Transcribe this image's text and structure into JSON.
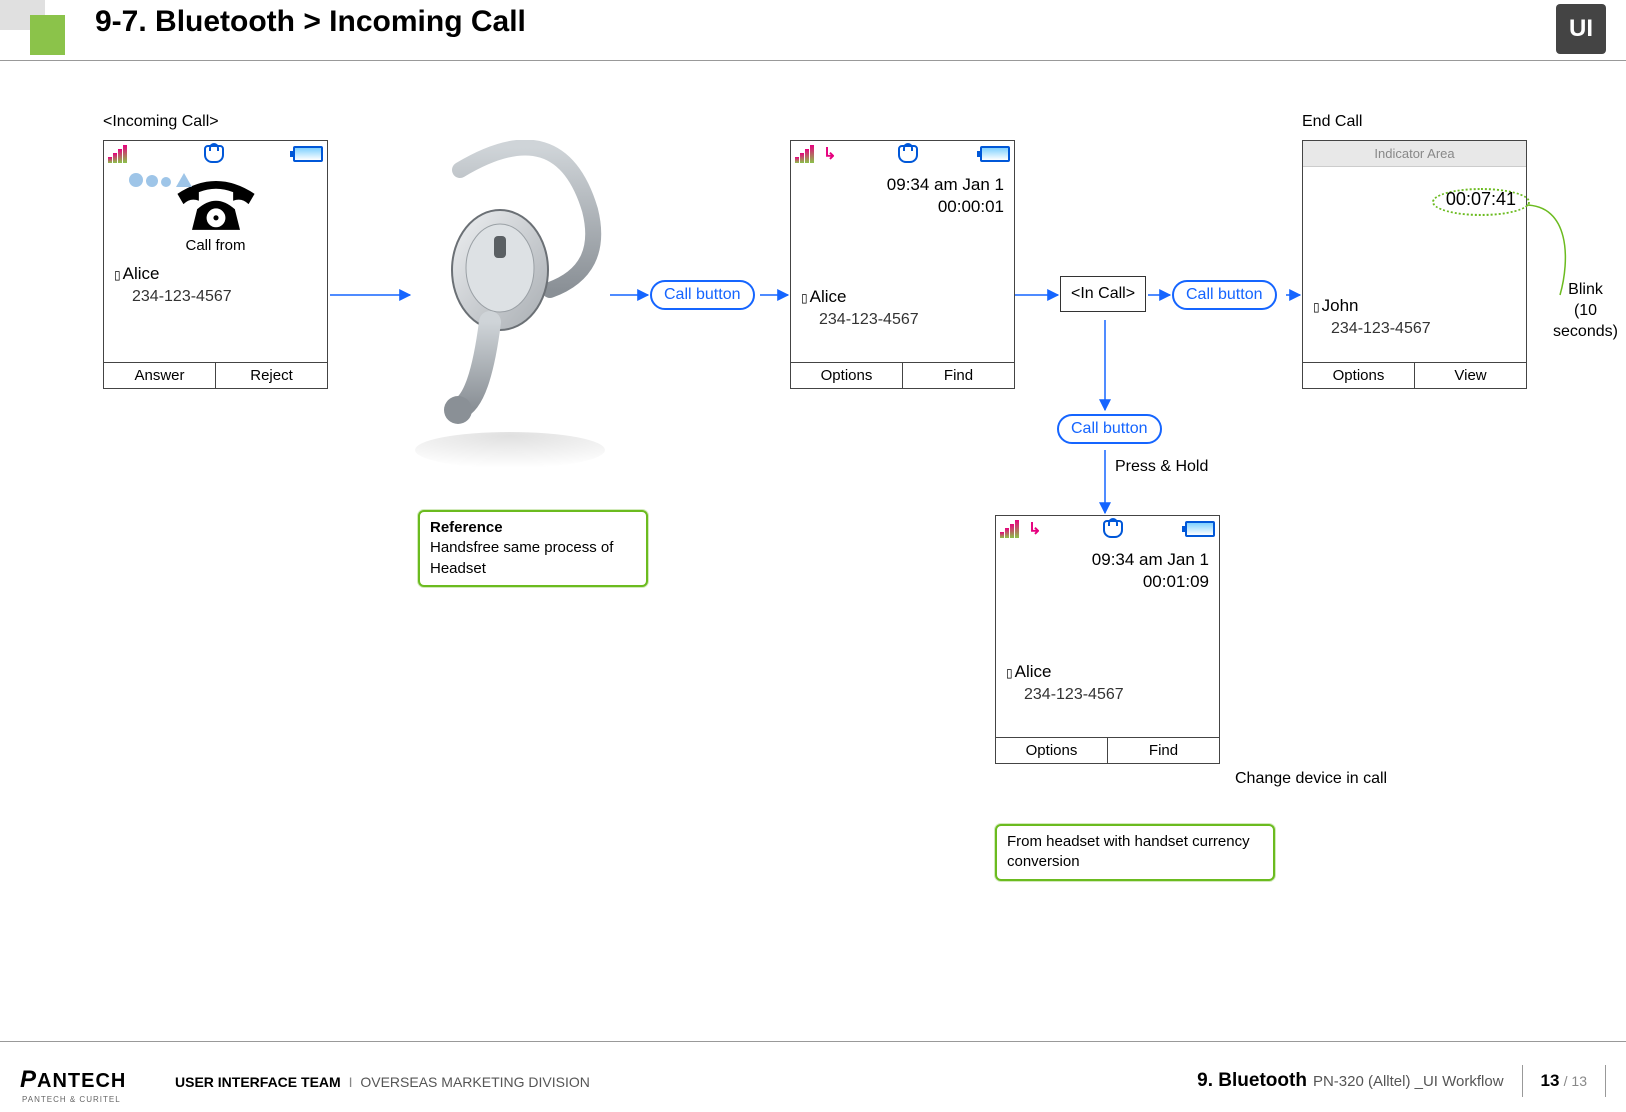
{
  "header": {
    "title": "9-7. Bluetooth > Incoming Call",
    "logo_text": "UI"
  },
  "footer": {
    "brand": "PANTECH",
    "brand_sub": "PANTECH & CURITEL",
    "team_bold": "USER INTERFACE TEAM",
    "team_light": "OVERSEAS MARKETING DIVISION",
    "section": "9. Bluetooth",
    "doc": "PN-320 (Alltel) _UI Workflow",
    "page_current": "13",
    "page_total": "/ 13"
  },
  "labels": {
    "incoming_call": "<Incoming Call>",
    "end_call": "End Call",
    "in_call": "<In Call>",
    "press_hold": "Press & Hold",
    "change_device": "Change device in call",
    "blink": "Blink",
    "blink_sub": "(10 seconds)",
    "indicator_area": "Indicator Area"
  },
  "pills": {
    "call_button_1": "Call button",
    "call_button_2": "Call button",
    "call_button_3": "Call button"
  },
  "notes": {
    "reference_title": "Reference",
    "reference_body": "Handsfree same process of Headset",
    "conversion": "From headset with handset currency conversion"
  },
  "screens": {
    "s1": {
      "call_from": "Call from",
      "name": "Alice",
      "number": "234-123-4567",
      "sk_left": "Answer",
      "sk_right": "Reject"
    },
    "s2": {
      "datetime": "09:34 am Jan 1",
      "timer": "00:00:01",
      "name": "Alice",
      "number": "234-123-4567",
      "sk_left": "Options",
      "sk_right": "Find"
    },
    "s3": {
      "timer": "00:07:41",
      "name": "John",
      "number": "234-123-4567",
      "sk_left": "Options",
      "sk_right": "View"
    },
    "s4": {
      "datetime": "09:34 am Jan 1",
      "timer": "00:01:09",
      "name": "Alice",
      "number": "234-123-4567",
      "sk_left": "Options",
      "sk_right": "Find"
    }
  }
}
